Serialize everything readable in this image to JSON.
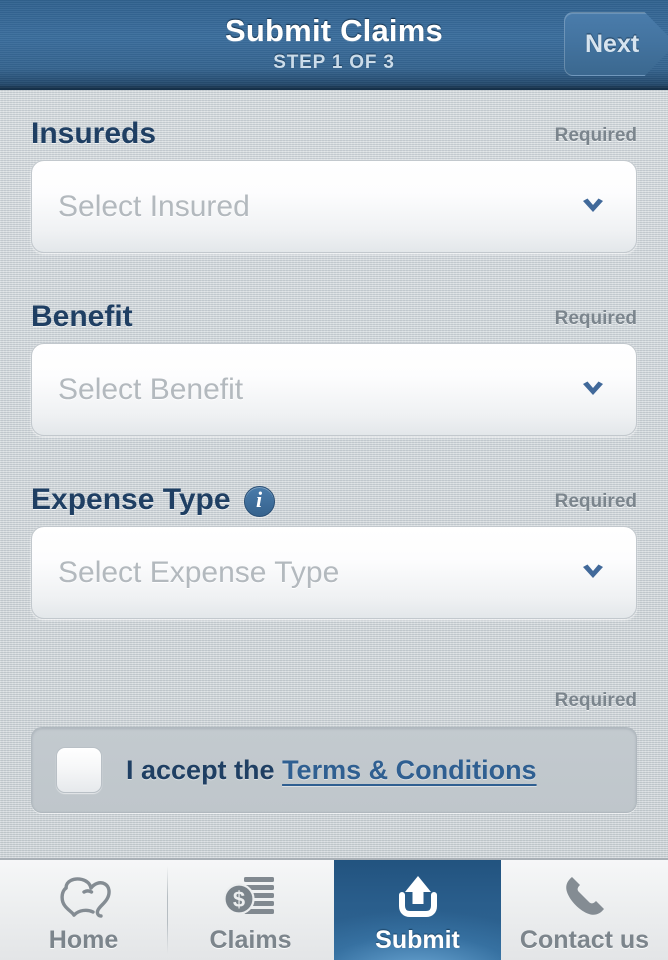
{
  "header": {
    "title": "Submit Claims",
    "subtitle": "STEP 1 OF 3",
    "next_label": "Next"
  },
  "form": {
    "fields": [
      {
        "label": "Insureds",
        "required_label": "Required",
        "placeholder": "Select Insured",
        "has_info_icon": false,
        "info_glyph": "i"
      },
      {
        "label": "Benefit",
        "required_label": "Required",
        "placeholder": "Select Benefit",
        "has_info_icon": false,
        "info_glyph": "i"
      },
      {
        "label": "Expense Type",
        "required_label": "Required",
        "placeholder": "Select Expense Type",
        "has_info_icon": true,
        "info_glyph": "i"
      }
    ],
    "terms": {
      "required_label": "Required",
      "accept_text": "I accept the ",
      "link_text": "Terms & Conditions",
      "checked": false
    }
  },
  "tabbar": {
    "tabs": [
      {
        "label": "Home",
        "icon": "elephant-icon",
        "active": false
      },
      {
        "label": "Claims",
        "icon": "coin-documents-icon",
        "active": false
      },
      {
        "label": "Submit",
        "icon": "upload-icon",
        "active": true
      },
      {
        "label": "Contact us",
        "icon": "phone-icon",
        "active": false
      }
    ]
  },
  "colors": {
    "header_blue": "#3b6e9d",
    "accent_blue": "#2f5f91",
    "label_navy": "#1f3f63",
    "required_gray": "#7b858d",
    "placeholder_gray": "#b3b9be",
    "background": "#c9d0d4",
    "active_tab_blue": "#2a5e8c"
  }
}
